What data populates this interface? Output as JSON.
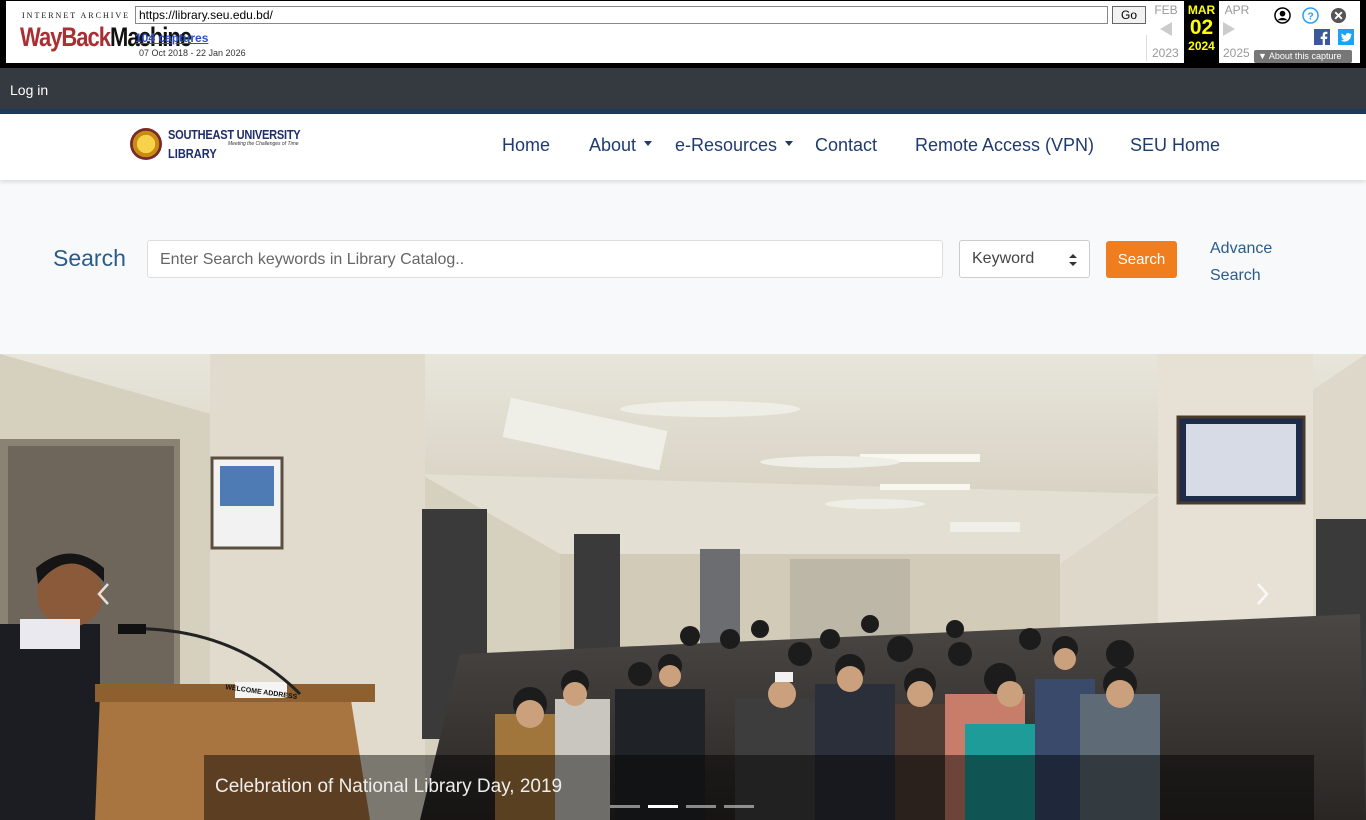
{
  "wayback": {
    "logo_top": "INTERNET ARCHIVE",
    "logo_a": "WayBack",
    "logo_b": "Machine",
    "url": "https://library.seu.edu.bd/",
    "go_label": "Go",
    "captures": "104 captures",
    "range": "07 Oct 2018 - 22 Jan 2026",
    "prev_month": "FEB",
    "cur_month": "MAR",
    "cur_day": "02",
    "cur_year": "2024",
    "next_month": "APR",
    "prev_year": "2023",
    "next_year": "2025",
    "about": "▼ About this capture"
  },
  "top": {
    "login": "Log in"
  },
  "brand": {
    "line1": "SOUTHEAST UNIVERSITY",
    "line2": "LIBRARY",
    "tagline": "Meeting the Challenges of Time"
  },
  "nav": {
    "home": "Home",
    "about": "About",
    "eresources": "e-Resources",
    "contact": "Contact",
    "vpn": "Remote Access (VPN)",
    "seu_home": "SEU Home"
  },
  "search": {
    "label": "Search",
    "placeholder": "Enter Search keywords in Library Catalog..",
    "type_selected": "Keyword",
    "button": "Search",
    "advance_line1": "Advance",
    "advance_line2": "Search"
  },
  "carousel": {
    "caption": "Celebration of National Library Day, 2019",
    "active_slide": 2,
    "slide_count": 4,
    "podium_sign": "WELCOME ADDRESS"
  },
  "colors": {
    "orange": "#f07e1e",
    "navy": "#1f3b6e",
    "dark_bar": "#343a40"
  }
}
